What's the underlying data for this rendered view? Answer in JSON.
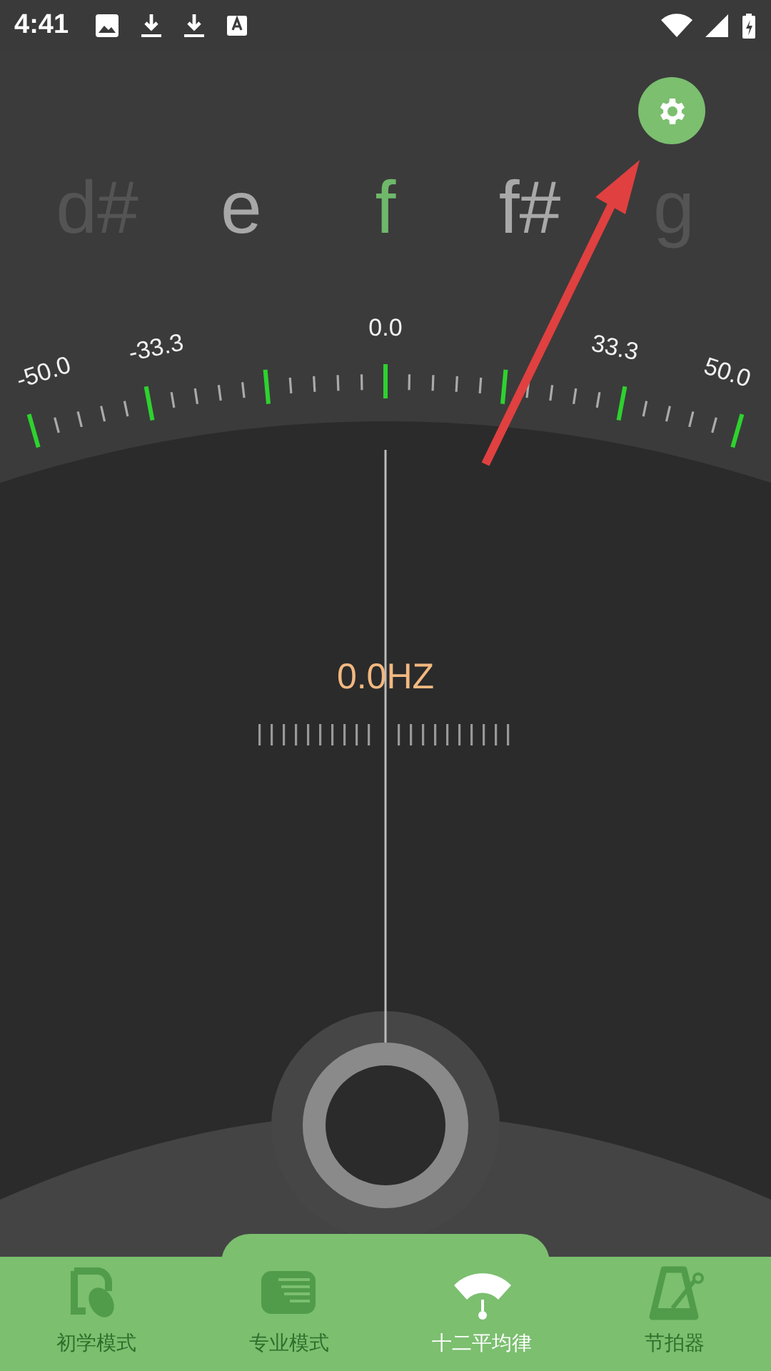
{
  "status_bar": {
    "time": "4:41"
  },
  "notes": [
    {
      "label": "d#",
      "selected": false,
      "kind": "far"
    },
    {
      "label": "e",
      "selected": false,
      "kind": "near"
    },
    {
      "label": "f",
      "selected": true,
      "kind": "near"
    },
    {
      "label": "f#",
      "selected": false,
      "kind": "near"
    },
    {
      "label": "g",
      "selected": false,
      "kind": "far"
    }
  ],
  "scale": {
    "labels": [
      "-50.0",
      "-33.3",
      "0.0",
      "33.3",
      "50.0"
    ]
  },
  "frequency": "0.0HZ",
  "nav": [
    {
      "label": "初学模式",
      "selected": false
    },
    {
      "label": "专业模式",
      "selected": false
    },
    {
      "label": "十二平均律",
      "selected": true
    },
    {
      "label": "节拍器",
      "selected": false
    }
  ]
}
